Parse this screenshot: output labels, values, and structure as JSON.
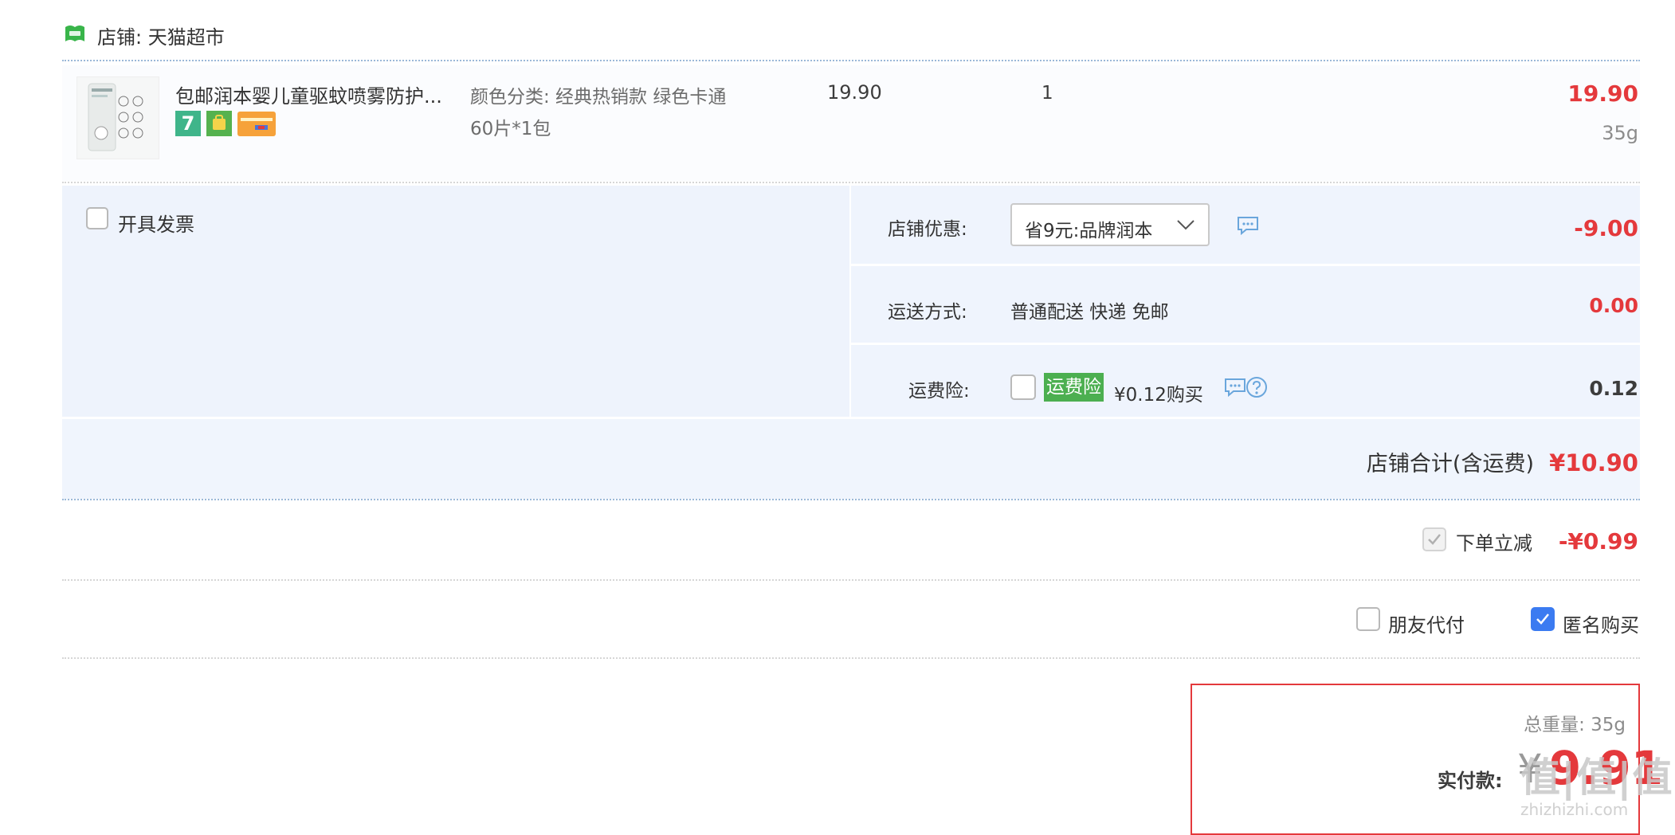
{
  "shop": {
    "label": "店铺:",
    "name": "天猫超市"
  },
  "item": {
    "title": "包邮润本婴儿童驱蚊喷雾防护...",
    "sku_line1": "颜色分类:  经典热销款 绿色卡通",
    "sku_line2": "60片*1包",
    "unit_price": "19.90",
    "quantity": "1",
    "subtotal": "19.90",
    "weight": "35g",
    "badges": [
      "7",
      "shop-icon",
      "card-icon"
    ]
  },
  "invoice": {
    "label": "开具发票"
  },
  "discount": {
    "label": "店铺优惠:",
    "selected": "省9元:品牌润本",
    "amount": "-9.00"
  },
  "shipping": {
    "label": "运送方式:",
    "value": "普通配送 快递 免邮",
    "amount": "0.00"
  },
  "insurance": {
    "label": "运费险:",
    "tag": "运费险",
    "price_text": "¥0.12购买",
    "amount": "0.12"
  },
  "shop_total": {
    "label": "店铺合计(含运费)",
    "amount": "¥10.90"
  },
  "instant_discount": {
    "label": "下单立减",
    "amount": "-¥0.99"
  },
  "options": {
    "friend_pay": "朋友代付",
    "anonymous": "匿名购买"
  },
  "summary": {
    "weight_label": "总重量:",
    "weight_value": "35g",
    "pay_label": "实付款:",
    "currency": "¥",
    "pay_amount": "9.91"
  },
  "watermark": {
    "top": "值|值|值",
    "bottom": "zhizhizhi.com"
  },
  "colors": {
    "price_red": "#e4393c",
    "panel_blue": "#f0f5fd",
    "checkbox_blue": "#3b7bf1",
    "insurance_green": "#4caf50",
    "tmall_green": "#39b54a"
  }
}
